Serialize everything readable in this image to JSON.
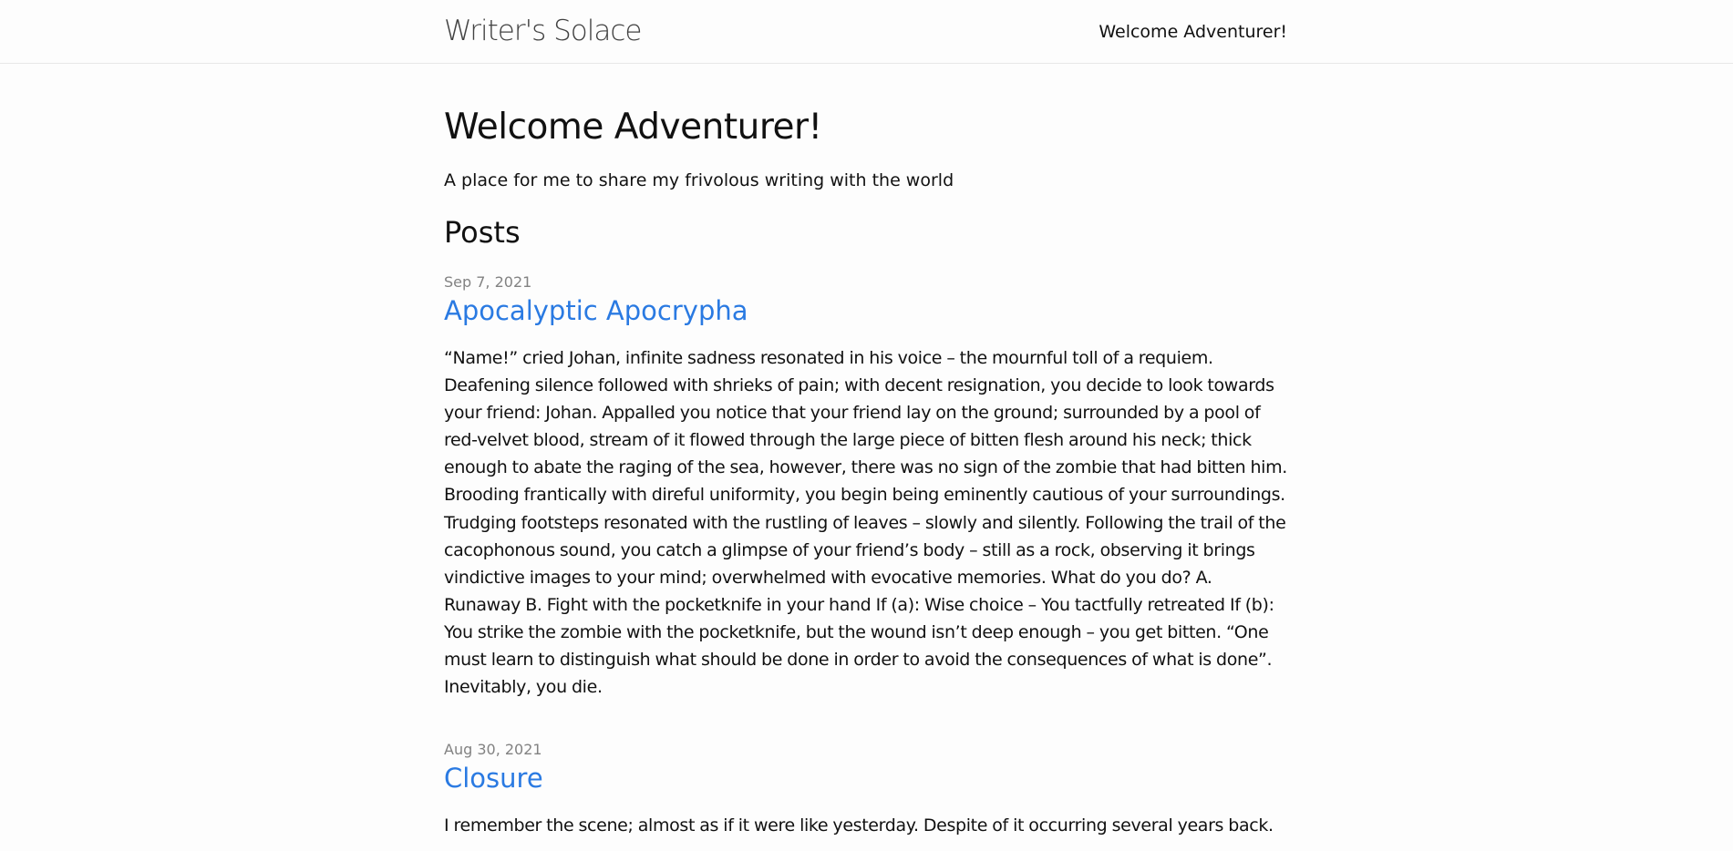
{
  "header": {
    "site_title": "Writer's Solace",
    "nav_link": "Welcome Adventurer!"
  },
  "home": {
    "heading": "Welcome Adventurer!",
    "tagline": "A place for me to share my frivolous writing with the world",
    "posts_heading": "Posts"
  },
  "posts": [
    {
      "date": "Sep 7, 2021",
      "title": "Apocalyptic Apocrypha",
      "excerpt": "“Name!” cried Johan, infinite sadness resonated in his voice – the mournful toll of a requiem. Deafening silence followed with shrieks of pain; with decent resignation, you decide to look towards your friend: Johan. Appalled you notice that your friend lay on the ground; surrounded by a pool of red-velvet blood, stream of it flowed through the large piece of bitten flesh around his neck; thick enough to abate the raging of the sea, however, there was no sign of the zombie that had bitten him. Brooding frantically with direful uniformity, you begin being eminently cautious of your surroundings. Trudging footsteps resonated with the rustling of leaves – slowly and silently. Following the trail of the cacophonous sound, you catch a glimpse of your friend’s body – still as a rock, observing it brings vindictive images to your mind; overwhelmed with evocative memories. What do you do? A. Runaway B. Fight with the pocketknife in your hand If (a): Wise choice – You tactfully retreated If (b): You strike the zombie with the pocketknife, but the wound isn’t deep enough – you get bitten. “One must learn to distinguish what should be done in order to avoid the consequences of what is done”. Inevitably, you die."
    },
    {
      "date": "Aug 30, 2021",
      "title": "Closure",
      "excerpt": "I remember the scene; almost as if it were like yesterday. Despite of it occurring several years back."
    }
  ],
  "colors": {
    "link": "#2a7ae2",
    "meta": "#828282",
    "text": "#111111",
    "background": "#fdfdfd"
  }
}
